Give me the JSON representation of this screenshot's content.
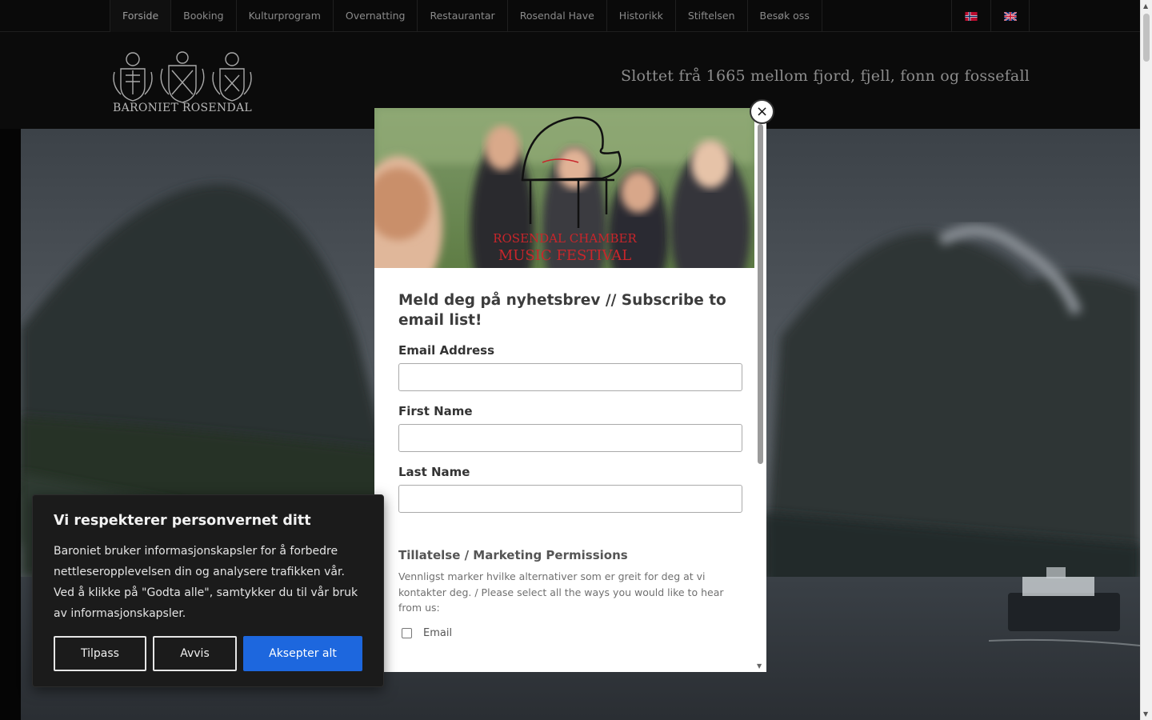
{
  "nav": {
    "items": [
      "Forside",
      "Booking",
      "Kulturprogram",
      "Overnatting",
      "Restaurantar",
      "Rosendal Have",
      "Historikk",
      "Stiftelsen",
      "Besøk oss"
    ],
    "languages": [
      "norwegian-flag-icon",
      "uk-flag-icon"
    ]
  },
  "header": {
    "logo_text": "BARONIET ROSENDAL",
    "tagline": "Slottet frå 1665 mellom fjord, fjell, fonn og fossefall"
  },
  "modal": {
    "image_logo_line1": "ROSENDAL CHAMBER",
    "image_logo_line2": "MUSIC FESTIVAL",
    "close_label": "×",
    "title": "Meld deg på nyhetsbrev // Subscribe to email list!",
    "fields": [
      {
        "label": "Email Address",
        "value": ""
      },
      {
        "label": "First Name",
        "value": ""
      },
      {
        "label": "Last Name",
        "value": ""
      }
    ],
    "permissions_title": "Tillatelse / Marketing Permissions",
    "permissions_text": "Vennligst marker hvilke alternativer som er greit for deg at vi kontakter deg. / Please select all the ways you would like to hear from us:",
    "permission_option": "Email"
  },
  "cookie": {
    "title": "Vi respekterer personvernet ditt",
    "text": "Baroniet bruker informasjonskapsler for å forbedre nettleseropplevelsen din og analysere trafikken vår. Ved å klikke på \"Godta alle\", samtykker du til vår bruk av informasjonskapsler.",
    "customize_label": "Tilpass",
    "reject_label": "Avvis",
    "accept_label": "Aksepter alt"
  },
  "colors": {
    "accept_button": "#1d67de",
    "accent_red": "#c8262b"
  }
}
